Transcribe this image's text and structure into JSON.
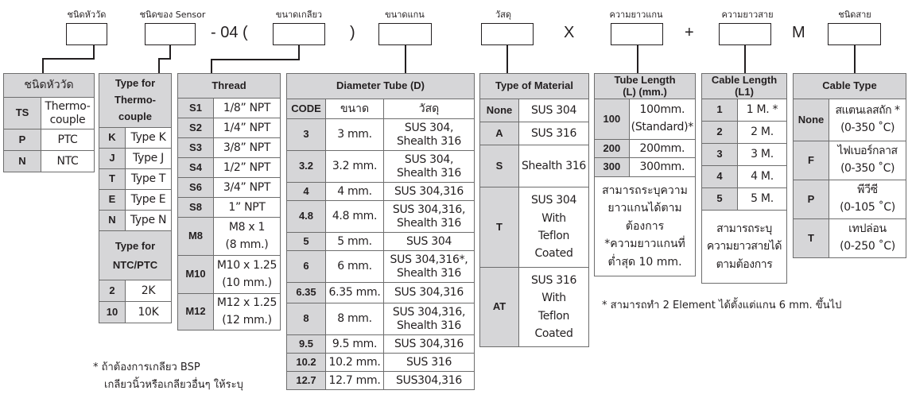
{
  "header": {
    "fields": [
      {
        "label": "ชนิดหัววัด"
      },
      {
        "label": "ชนิดของ Sensor"
      },
      {
        "label": "ขนาดเกลียว"
      },
      {
        "label": "ขนาดแกน"
      },
      {
        "label": "วัสดุ"
      },
      {
        "label": "ความยาวแกน"
      },
      {
        "label": "ความยาวสาย"
      },
      {
        "label": "ชนิดสาย"
      }
    ],
    "separators": {
      "dash_04_open": "- 04 (",
      "close_paren": ")",
      "x": "X",
      "plus": "+",
      "m": "M"
    }
  },
  "sensor_head": {
    "title": "ชนิดหัววัด",
    "rows": [
      {
        "code": "TS",
        "value": "Thermo-couple",
        "value_l1": "Thermo-",
        "value_l2": "couple"
      },
      {
        "code": "P",
        "value": "PTC"
      },
      {
        "code": "N",
        "value": "NTC"
      }
    ]
  },
  "sensor_type": {
    "title_l1": "Type for",
    "title_l2": "Thermo-",
    "title_l3": "couple",
    "rows": [
      {
        "code": "K",
        "value": "Type K"
      },
      {
        "code": "J",
        "value": "Type J"
      },
      {
        "code": "T",
        "value": "Type T"
      },
      {
        "code": "E",
        "value": "Type E"
      },
      {
        "code": "N",
        "value": "Type N"
      }
    ],
    "ntc_title_l1": "Type for",
    "ntc_title_l2": "NTC/PTC",
    "ntc_rows": [
      {
        "code": "2",
        "value": "2K"
      },
      {
        "code": "10",
        "value": "10K"
      }
    ]
  },
  "thread": {
    "title": "Thread",
    "rows": [
      {
        "code": "S1",
        "value": "1/8” NPT"
      },
      {
        "code": "S2",
        "value": "1/4” NPT"
      },
      {
        "code": "S3",
        "value": "3/8” NPT"
      },
      {
        "code": "S4",
        "value": "1/2” NPT"
      },
      {
        "code": "S6",
        "value": "3/4” NPT"
      },
      {
        "code": "S8",
        "value": "1” NPT"
      },
      {
        "code": "M8",
        "value_l1": "M8 x 1",
        "value_l2": "(8 mm.)"
      },
      {
        "code": "M10",
        "value_l1": "M10 x 1.25",
        "value_l2": "(10 mm.)"
      },
      {
        "code": "M12",
        "value_l1": "M12 x 1.25",
        "value_l2": "(12 mm.)"
      }
    ],
    "footnote_l1": "* ถ้าต้องการเกลียว BSP",
    "footnote_l2": "เกลียวนิ้วหรือเกลียวอื่นๆ ให้ระบุ"
  },
  "diameter": {
    "title": "Diameter Tube (D)",
    "columns": [
      "CODE",
      "ขนาด",
      "วัสดุ"
    ],
    "rows": [
      {
        "code": "3",
        "size": "3 mm.",
        "mat_l1": "SUS 304,",
        "mat_l2": "Shealth 316"
      },
      {
        "code": "3.2",
        "size": "3.2 mm.",
        "mat_l1": "SUS 304,",
        "mat_l2": "Shealth 316"
      },
      {
        "code": "4",
        "size": "4 mm.",
        "mat_l1": "SUS 304,316"
      },
      {
        "code": "4.8",
        "size": "4.8 mm.",
        "mat_l1": "SUS 304,316,",
        "mat_l2": "Shealth 316"
      },
      {
        "code": "5",
        "size": "5 mm.",
        "mat_l1": "SUS 304"
      },
      {
        "code": "6",
        "size": "6 mm.",
        "mat_l1": "SUS 304,316*,",
        "mat_l2": "Shealth 316"
      },
      {
        "code": "6.35",
        "size": "6.35 mm.",
        "mat_l1": "SUS 304,316"
      },
      {
        "code": "8",
        "size": "8 mm.",
        "mat_l1": "SUS 304,316,",
        "mat_l2": "Shealth 316"
      },
      {
        "code": "9.5",
        "size": "9.5 mm.",
        "mat_l1": "SUS 304,316"
      },
      {
        "code": "10.2",
        "size": "10.2 mm.",
        "mat_l1": "SUS 316"
      },
      {
        "code": "12.7",
        "size": "12.7 mm.",
        "mat_l1": "SUS304,316"
      }
    ]
  },
  "material": {
    "title": "Type of Material",
    "rows": [
      {
        "code": "None",
        "lines": [
          "SUS 304"
        ]
      },
      {
        "code": "A",
        "lines": [
          "SUS 316"
        ]
      },
      {
        "code": "S",
        "lines": [
          "Shealth 316"
        ]
      },
      {
        "code": "T",
        "lines": [
          "SUS 304",
          "With",
          "Teflon",
          "Coated"
        ]
      },
      {
        "code": "AT",
        "lines": [
          "SUS 316",
          "With",
          "Teflon",
          "Coated"
        ]
      }
    ]
  },
  "tube_length": {
    "title_l1": "Tube Length",
    "title_l2": "(L) (mm.)",
    "rows": [
      {
        "code": "100",
        "value_l1": "100mm.",
        "value_l2": "(Standard)*"
      },
      {
        "code": "200",
        "value_l1": "200mm."
      },
      {
        "code": "300",
        "value_l1": "300mm."
      }
    ],
    "note_lines": [
      "สามารถระบุความ",
      "ยาวแกนได้ตาม",
      "ต้องการ",
      "*ความยาวแกนที่",
      "ต่ำสุด 10 mm."
    ]
  },
  "cable_length": {
    "title_l1": "Cable Length",
    "title_l2": "(L1)",
    "rows": [
      {
        "code": "1",
        "value": "1 M. *"
      },
      {
        "code": "2",
        "value": "2 M."
      },
      {
        "code": "3",
        "value": "3 M."
      },
      {
        "code": "4",
        "value": "4 M."
      },
      {
        "code": "5",
        "value": "5 M."
      }
    ],
    "note_lines": [
      "สามารถระบุ",
      "ความยาวสายได้",
      "ตามต้องการ"
    ]
  },
  "cable_type": {
    "title": "Cable Type",
    "rows": [
      {
        "code": "None",
        "value_l1": "สแตนเลสถัก *",
        "value_l2": "(0-350 ˚C)"
      },
      {
        "code": "F",
        "value_l1": "ไฟเบอร์กลาส",
        "value_l2": "(0-350 ˚C)"
      },
      {
        "code": "P",
        "value_l1": "พีวีซี",
        "value_l2": "(0-105 ˚C)"
      },
      {
        "code": "T",
        "value_l1": "เทปล่อน",
        "value_l2": "(0-250 ˚C)"
      }
    ]
  },
  "element_note": "* สามารถทำ 2 Element ได้ตั้งแต่แกน 6 mm. ขึ้นไป"
}
